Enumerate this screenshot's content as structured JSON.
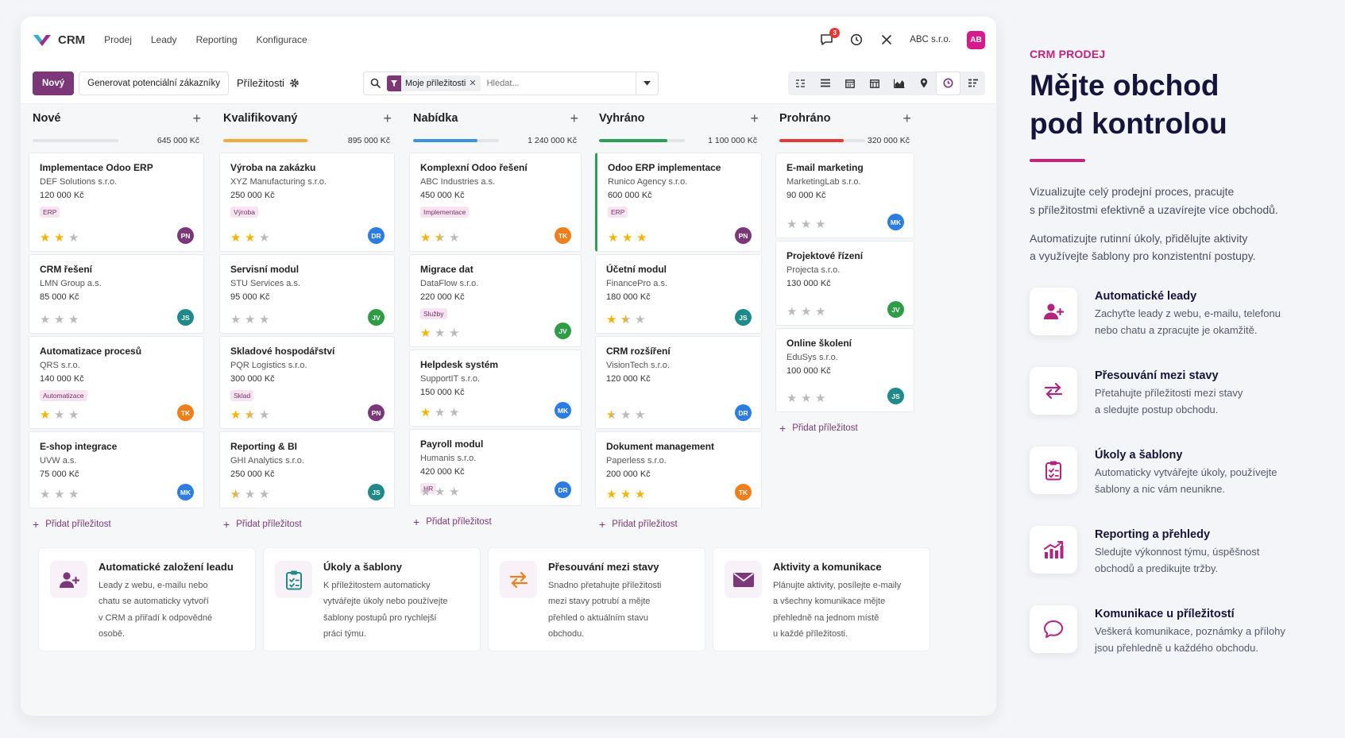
{
  "topbar": {
    "app_name": "CRM",
    "menu": [
      "Prodej",
      "Leady",
      "Reporting",
      "Konfigurace"
    ],
    "message_count": "3",
    "company": "ABC s.r.o.",
    "user_initials": "AB"
  },
  "controls": {
    "new_label": "Nový",
    "generate_label": "Generovat potenciální zákazníky",
    "breadcrumb": "Příležitosti",
    "facet_label": "Moje příležitosti",
    "search_placeholder": "Hledat..."
  },
  "avatar_colors": {
    "PN": "#7b3777",
    "DR": "#2b7de1",
    "TK": "#f07f1b",
    "JS": "#1f8a8a",
    "JV": "#2e9d45",
    "MK": "#2b7de1"
  },
  "columns": [
    {
      "name": "Nové",
      "amount": "645 000 Kč",
      "color": "#cfd2d8",
      "progress": 0.0,
      "cards": [
        {
          "title": "Implementace Odoo ERP",
          "company": "DEF Solutions s.r.o.",
          "value": "120 000 Kč",
          "tag": "ERP",
          "stars": 2,
          "avatar": "PN"
        },
        {
          "title": "CRM řešení",
          "company": "LMN Group a.s.",
          "value": "85 000 Kč",
          "tag": "",
          "stars": 0,
          "avatar": "JS"
        },
        {
          "title": "Automatizace procesů",
          "company": "QRS s.r.o.",
          "value": "140 000 Kč",
          "tag": "Automatizace",
          "stars": 1,
          "avatar": "TK"
        },
        {
          "title": "E-shop integrace",
          "company": "UVW a.s.",
          "value": "75 000 Kč",
          "tag": "",
          "stars": 0,
          "avatar": "MK"
        }
      ]
    },
    {
      "name": "Kvalifikovaný",
      "amount": "895 000 Kč",
      "color": "#f4a93b",
      "progress": 0.98,
      "cards": [
        {
          "title": "Výroba na zakázku",
          "company": "XYZ Manufacturing s.r.o.",
          "value": "250 000 Kč",
          "tag": "Výroba",
          "stars": 2,
          "avatar": "DR"
        },
        {
          "title": "Servisní modul",
          "company": "STU Services a.s.",
          "value": "95 000 Kč",
          "tag": "",
          "stars": 0,
          "avatar": "JV"
        },
        {
          "title": "Skladové hospodářství",
          "company": "PQR Logistics s.r.o.",
          "value": "300 000 Kč",
          "tag": "Sklad",
          "stars": 1.5,
          "avatar": "PN"
        },
        {
          "title": "Reporting & BI",
          "company": "GHI Analytics s.r.o.",
          "value": "250 000 Kč",
          "tag": "",
          "stars": 0.5,
          "avatar": "JS"
        }
      ]
    },
    {
      "name": "Nabídka",
      "amount": "1 240 000 Kč",
      "color": "#3b93e0",
      "progress": 0.75,
      "cards": [
        {
          "title": "Komplexní Odoo řešení",
          "company": "ABC Industries a.s.",
          "value": "450 000 Kč",
          "tag": "Implementace",
          "stars": 1.5,
          "avatar": "TK"
        },
        {
          "title": "Migrace dat",
          "company": "DataFlow s.r.o.",
          "value": "220 000 Kč",
          "tag": "Služby",
          "stars": 1,
          "avatar": "JV"
        },
        {
          "title": "Helpdesk systém",
          "company": "SupportIT s.r.o.",
          "value": "150 000 Kč",
          "tag": "",
          "stars": 1,
          "avatar": "MK"
        },
        {
          "title": "Payroll modul",
          "company": "Humanis s.r.o.",
          "value": "420 000 Kč",
          "tag": "HR",
          "stars": 0,
          "avatar": "DR"
        }
      ]
    },
    {
      "name": "Vyhráno",
      "amount": "1 100 000 Kč",
      "color": "#2e9d55",
      "progress": 0.8,
      "cards": [
        {
          "title": "Odoo ERP implementace",
          "company": "Runico Agency s.r.o.",
          "value": "600 000 Kč",
          "tag": "ERP",
          "stars": 3,
          "avatar": "PN"
        },
        {
          "title": "Účetní modul",
          "company": "FinancePro a.s.",
          "value": "180 000 Kč",
          "tag": "",
          "stars": 1.5,
          "avatar": "JS"
        },
        {
          "title": "CRM rozšíření",
          "company": "VisionTech s.r.o.",
          "value": "120 000 Kč",
          "tag": "",
          "stars": 0.5,
          "avatar": "DR"
        },
        {
          "title": "Dokument management",
          "company": "Paperless s.r.o.",
          "value": "200 000 Kč",
          "tag": "",
          "stars": 3,
          "avatar": "TK"
        }
      ]
    },
    {
      "name": "Prohráno",
      "amount": "320 000 Kč",
      "color": "#e53935",
      "progress": 0.75,
      "cards": [
        {
          "title": "E-mail marketing",
          "company": "MarketingLab s.r.o.",
          "value": "90 000 Kč",
          "tag": "",
          "stars": 0,
          "avatar": "MK"
        },
        {
          "title": "Projektové řízení",
          "company": "Projecta s.r.o.",
          "value": "130 000 Kč",
          "tag": "",
          "stars": 0,
          "avatar": "JV"
        },
        {
          "title": "Online školení",
          "company": "EduSys s.r.o.",
          "value": "100 000 Kč",
          "tag": "",
          "stars": 0,
          "avatar": "JS"
        }
      ]
    }
  ],
  "add_opportunity_label": "Přidat příležitost",
  "features": [
    {
      "icon": "add-user-icon",
      "title": "Automatické založení leadu",
      "lines": [
        "Leady z webu, e-mailu nebo",
        "chatu se automaticky vytvoří",
        "v CRM a přiřadí k odpovědné",
        "osobě."
      ]
    },
    {
      "icon": "clipboard-icon",
      "title": "Úkoly a šablony",
      "lines": [
        "K příležitostem automaticky",
        "vytvářejte úkoly nebo používejte",
        "šablony postupů pro rychlejší",
        "práci týmu."
      ]
    },
    {
      "icon": "swap-arrows-icon",
      "title": "Přesouvání mezi stavy",
      "lines": [
        "Snadno přetahujte příležitosti",
        "mezi stavy potrubí a mějte",
        "přehled o aktuálním stavu",
        "obchodu."
      ]
    },
    {
      "icon": "envelope-icon",
      "title": "Aktivity a komunikace",
      "lines": [
        "Plánujte aktivity, posílejte e-maily",
        "a všechny komunikace mějte",
        "přehledně na jednom místě",
        "u každé příležitosti."
      ]
    }
  ],
  "panel": {
    "eyebrow": "CRM PRODEJ",
    "title_lines": [
      "Mějte obchod",
      "pod kontrolou"
    ],
    "paragraph1": [
      "Vizualizujte celý prodejní proces, pracujte",
      "s příležitostmi efektivně a uzavírejte více obchodů."
    ],
    "paragraph2": [
      "Automatizujte rutinní úkoly, přidělujte aktivity",
      "a využívejte šablony pro konzistentní postupy."
    ],
    "features": [
      {
        "icon": "add-user-icon",
        "title": "Automatické leady",
        "lines": [
          "Zachyťte leady z webu, e-mailu, telefonu",
          "nebo chatu a zpracujte je okamžitě."
        ]
      },
      {
        "icon": "swap-arrows-icon",
        "title": "Přesouvání mezi stavy",
        "lines": [
          "Přetahujte příležitosti mezi stavy",
          "a sledujte postup obchodu."
        ]
      },
      {
        "icon": "clipboard-icon",
        "title": "Úkoly a šablony",
        "lines": [
          "Automaticky vytvářejte úkoly, používejte",
          "šablony a nic vám neunikne."
        ]
      },
      {
        "icon": "bar-chart-icon",
        "title": "Reporting a přehledy",
        "lines": [
          "Sledujte výkonnost týmu, úspěšnost",
          "obchodů a predikujte tržby."
        ]
      },
      {
        "icon": "chat-bubble-icon",
        "title": "Komunikace u příležitostí",
        "lines": [
          "Veškerá komunikace, poznámky a přílohy",
          "jsou přehledně u každého obchodu."
        ]
      }
    ]
  }
}
